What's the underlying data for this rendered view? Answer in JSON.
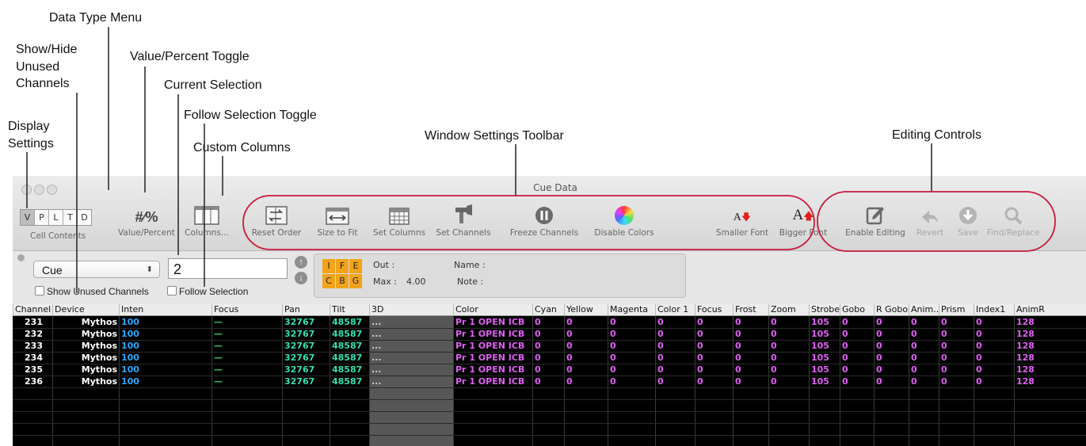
{
  "callouts": {
    "data_type_menu": "Data Type Menu",
    "show_hide_1": "Show/Hide",
    "show_hide_2": "Unused",
    "show_hide_3": "Channels",
    "value_percent_toggle": "Value/Percent Toggle",
    "current_selection": "Current Selection",
    "follow_selection_toggle": "Follow Selection Toggle",
    "display_1": "Display",
    "display_2": "Settings",
    "custom_columns": "Custom Columns",
    "window_settings_toolbar": "Window Settings Toolbar",
    "editing_controls": "Editing Controls"
  },
  "window": {
    "title": "Cue Data"
  },
  "cell_contents": {
    "segments": [
      "V",
      "P",
      "L",
      "T",
      "D"
    ],
    "selected": "V",
    "label": "Cell Contents"
  },
  "toolbar": {
    "value_percent": {
      "glyph": "#⁄%",
      "label": "Value/Percent"
    },
    "columns": "Columns...",
    "reset_order": "Reset Order",
    "size_to_fit": "Size to Fit",
    "set_columns": "Set Columns",
    "set_channels": "Set Channels",
    "freeze_channels": "Freeze Channels",
    "disable_colors": "Disable Colors",
    "smaller_font": "Smaller Font",
    "bigger_font": "Bigger Font",
    "enable_editing": "Enable Editing",
    "revert": "Revert",
    "save": "Save",
    "find_replace": "Find/Replace"
  },
  "controls": {
    "data_type": "Cue",
    "show_unused_channels": "Show Unused Channels",
    "follow_selection": "Follow Selection",
    "current_selection": "2",
    "ife": [
      "I",
      "F",
      "E",
      "C",
      "B",
      "G"
    ],
    "out_label": "Out :",
    "max_label": "Max :",
    "max_value": "4.00",
    "name_label": "Name :",
    "note_label": "Note :"
  },
  "table": {
    "columns": [
      "Channel",
      "Device",
      "Inten",
      "Focus",
      "Pan",
      "Tilt",
      "3D",
      "Color",
      "Cyan",
      "Yellow",
      "Magenta",
      "Color 1",
      "Focus",
      "Frost",
      "Zoom",
      "Strobe",
      "Gobo",
      "R Gobo",
      "Anim...",
      "Prism",
      "Index1",
      "AnimR"
    ],
    "rows": [
      [
        "231",
        "Mythos",
        "100",
        "—",
        "32767",
        "48587",
        "...",
        "Pr 1 OPEN ICB",
        "0",
        "0",
        "0",
        "0",
        "0",
        "0",
        "0",
        "105",
        "0",
        "0",
        "0",
        "0",
        "0",
        "128"
      ],
      [
        "232",
        "Mythos",
        "100",
        "—",
        "32767",
        "48587",
        "...",
        "Pr 1 OPEN ICB",
        "0",
        "0",
        "0",
        "0",
        "0",
        "0",
        "0",
        "105",
        "0",
        "0",
        "0",
        "0",
        "0",
        "128"
      ],
      [
        "233",
        "Mythos",
        "100",
        "—",
        "32767",
        "48587",
        "...",
        "Pr 1 OPEN ICB",
        "0",
        "0",
        "0",
        "0",
        "0",
        "0",
        "0",
        "105",
        "0",
        "0",
        "0",
        "0",
        "0",
        "128"
      ],
      [
        "234",
        "Mythos",
        "100",
        "—",
        "32767",
        "48587",
        "...",
        "Pr 1 OPEN ICB",
        "0",
        "0",
        "0",
        "0",
        "0",
        "0",
        "0",
        "105",
        "0",
        "0",
        "0",
        "0",
        "0",
        "128"
      ],
      [
        "235",
        "Mythos",
        "100",
        "—",
        "32767",
        "48587",
        "...",
        "Pr 1 OPEN ICB",
        "0",
        "0",
        "0",
        "0",
        "0",
        "0",
        "0",
        "105",
        "0",
        "0",
        "0",
        "0",
        "0",
        "128"
      ],
      [
        "236",
        "Mythos",
        "100",
        "—",
        "32767",
        "48587",
        "...",
        "Pr 1 OPEN ICB",
        "0",
        "0",
        "0",
        "0",
        "0",
        "0",
        "0",
        "105",
        "0",
        "0",
        "0",
        "0",
        "0",
        "128"
      ]
    ]
  },
  "colors": {
    "intensity": "#2aa8ff",
    "focus": "#33cc66",
    "position": "#33e0b0",
    "beam": "#e15ff5",
    "ife_orange": "#f2a319",
    "callout_border": "#c8193b"
  }
}
